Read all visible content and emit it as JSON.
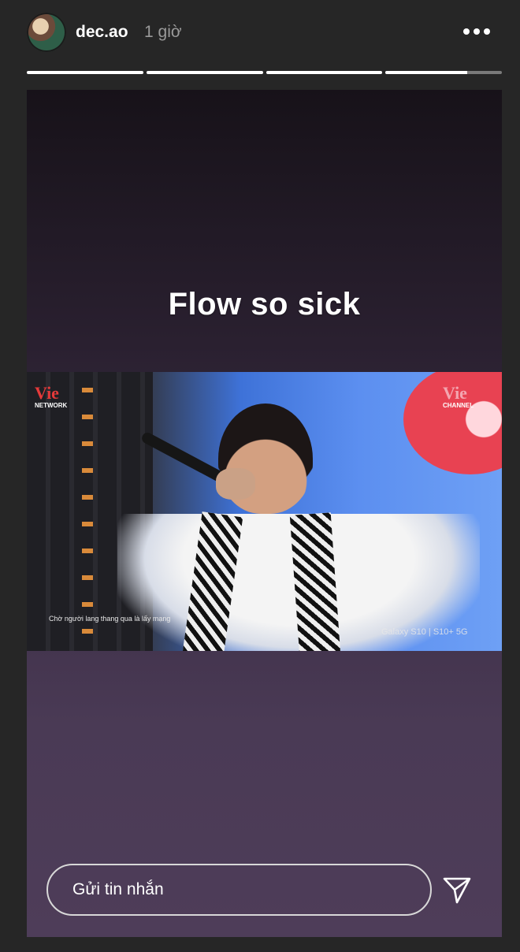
{
  "header": {
    "username": "dec.ao",
    "time": "1 giờ",
    "more_icon": "more-horizontal-icon"
  },
  "progress": {
    "segments": [
      1,
      1,
      1,
      0.7
    ]
  },
  "story": {
    "caption": "Flow so sick",
    "video": {
      "logo_left": "Vie",
      "logo_left_sub": "NETWORK",
      "logo_right": "Vie",
      "logo_right_sub": "CHANNEL",
      "subtitle": "Chờ người lang thang qua là lấy mạng",
      "watermark": "Galaxy S10 | S10+ 5G"
    }
  },
  "reply": {
    "placeholder": "Gửi tin nhắn",
    "send_icon": "send-icon"
  }
}
